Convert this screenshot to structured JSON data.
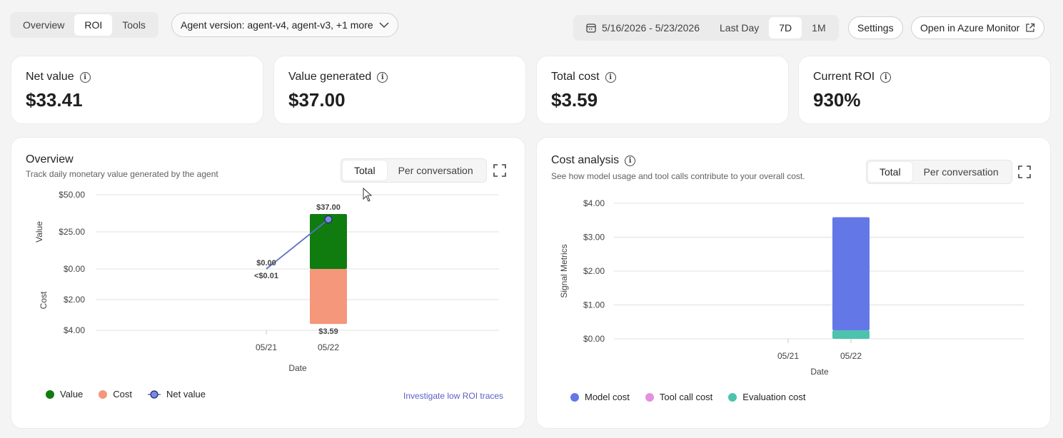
{
  "header": {
    "tabs": [
      "Overview",
      "ROI",
      "Tools"
    ],
    "active_tab": 1,
    "agent_version_label": "Agent version: agent-v4, agent-v3, +1 more",
    "date_range": "5/16/2026 - 5/23/2026",
    "range_options": [
      "Last Day",
      "7D",
      "1M"
    ],
    "active_range": "7D",
    "settings_label": "Settings",
    "azure_label": "Open in Azure Monitor"
  },
  "kpis": [
    {
      "label": "Net value",
      "value": "$33.41"
    },
    {
      "label": "Value generated",
      "value": "$37.00"
    },
    {
      "label": "Total cost",
      "value": "$3.59"
    },
    {
      "label": "Current ROI",
      "value": "930%"
    }
  ],
  "overview": {
    "title": "Overview",
    "subtitle": "Track daily monetary value generated by the agent",
    "toggle": [
      "Total",
      "Per conversation"
    ],
    "legend": [
      "Value",
      "Cost",
      "Net value"
    ],
    "link": "Investigate low ROI traces"
  },
  "cost": {
    "title": "Cost analysis",
    "subtitle": "See how model usage and tool calls contribute to your overall cost.",
    "toggle": [
      "Total",
      "Per conversation"
    ],
    "legend": [
      "Model cost",
      "Tool call cost",
      "Evaluation cost"
    ]
  },
  "colors": {
    "value": "#107c10",
    "cost": "#f4977a",
    "net_value": "#5b6fc7",
    "model_cost": "#6378e6",
    "tool_call_cost": "#e58fe0",
    "evaluation_cost": "#4cc3ad"
  },
  "chart_data": [
    {
      "type": "bar",
      "title": "Overview",
      "xlabel": "Date",
      "ylabel_top": "Value",
      "ylabel_bottom": "Cost",
      "categories": [
        "05/21",
        "05/22"
      ],
      "value_ticks": [
        "$50.00",
        "$25.00",
        "$0.00"
      ],
      "cost_ticks": [
        "$2.00",
        "$4.00"
      ],
      "value_ylim": [
        0,
        50
      ],
      "cost_ylim": [
        0,
        4
      ],
      "series": [
        {
          "name": "Value",
          "values": [
            0,
            37.0
          ]
        },
        {
          "name": "Cost",
          "values": [
            0.004,
            3.59
          ]
        },
        {
          "name": "Net value",
          "type": "line",
          "values": [
            0,
            33.41
          ]
        }
      ],
      "annotations": {
        "value_label": "$37.00",
        "cost_label": "$3.59",
        "first_value_label": "$0.00",
        "first_cost_label": "<$0.01"
      }
    },
    {
      "type": "bar",
      "title": "Cost analysis",
      "xlabel": "Date",
      "ylabel": "Signal Metrics",
      "categories": [
        "05/21",
        "05/22"
      ],
      "ticks": [
        "$4.00",
        "$3.00",
        "$2.00",
        "$1.00",
        "$0.00"
      ],
      "ylim": [
        0,
        4
      ],
      "stacked": true,
      "series": [
        {
          "name": "Evaluation cost",
          "values": [
            0,
            0.25
          ]
        },
        {
          "name": "Tool call cost",
          "values": [
            0,
            0
          ]
        },
        {
          "name": "Model cost",
          "values": [
            0,
            3.34
          ]
        }
      ]
    }
  ]
}
